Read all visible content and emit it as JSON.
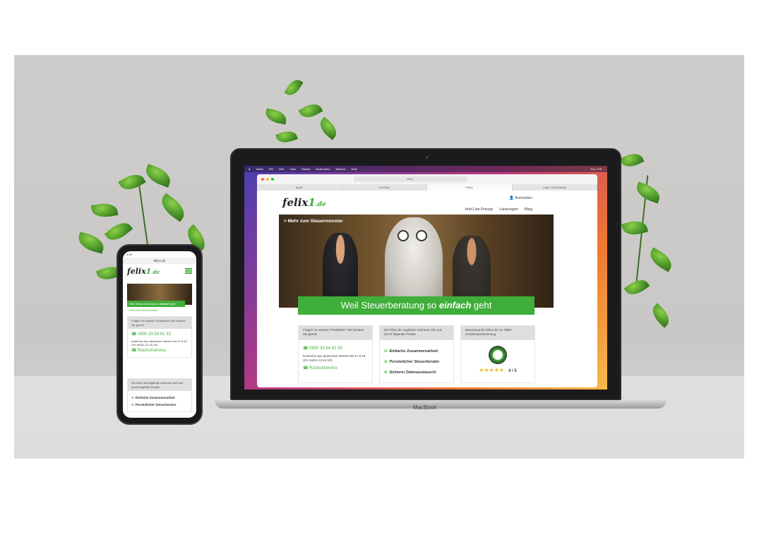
{
  "brand": {
    "logo_main": "felix",
    "logo_one": "1",
    "logo_tld": ".de",
    "accent": "#3fae3a"
  },
  "laptop": {
    "label": "MacBook",
    "menubar": [
      "Safari",
      "File",
      "Edit",
      "View",
      "History",
      "Bookmarks",
      "Window",
      "Help"
    ],
    "clock": "Thu 7:00",
    "address": "felix1",
    "tabs": [
      "Apple",
      "YouTube",
      "Felix1",
      "Login | Grammarly"
    ]
  },
  "site": {
    "login": "Anmelden",
    "nav": [
      "felix1.de-Prinzip",
      "Leistungen",
      "Blog"
    ],
    "hero_link": "> Mehr zum Steuermonster",
    "banner_pre": "Weil Steuerberatung so ",
    "banner_em": "einfach",
    "banner_post": " geht",
    "card1": {
      "head": "Fragen zu unseren Produkten? Wir beraten Sie gerne!",
      "phone": "0800 33 54 91 33",
      "hours": "kostenlos aus deutschen Netzen Mo-Fr 8-19 Uhr Sa/So 12-16 Uhr",
      "callback": "Rückrufservice"
    },
    "card2": {
      "head": "Die felix1.de Angebote zeichnen sich aus durch folgende Punkte",
      "items": [
        "Einfache Zusammenarbeit",
        "Persönlicher Steuerberater",
        "Sicherer Datenaustausch"
      ]
    },
    "card3": {
      "head": "Bewertung für felix1.de AG StBG Kundenauszeichnung",
      "stars": "★★★★★",
      "score": "4 / 5"
    }
  },
  "phone": {
    "time": "4:20",
    "url": "felix1.de",
    "banner_pre": "Weil Steuerberatung so ",
    "banner_em": "einfach",
    "banner_post": " geht",
    "hero_link": "> Mehr zum Steuermonster",
    "card1_head": "Fragen zu unseren Produkten? Wir beraten Sie gerne!",
    "phone": "0800 33 54 91 33",
    "hours": "kostenlos aus deutschen Netzen Mo-Fr 8-19 Uhr Sa/So 12-16 Uhr",
    "callback": "Rückrufservice",
    "card2_head": "Die felix1.de Angebote zeichnen sich aus durch folgende Punkte",
    "items": [
      "Einfache Zusammenarbeit",
      "Persönlicher Steuerberater"
    ]
  }
}
